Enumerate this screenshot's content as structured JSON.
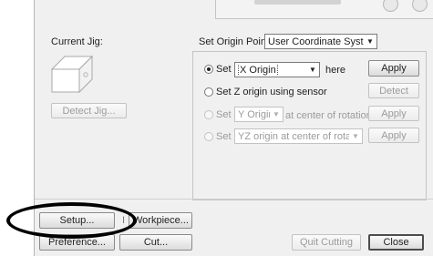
{
  "left": {
    "current_jig_label": "Current Jig:",
    "detect_jig_button": "Detect Jig..."
  },
  "origin": {
    "set_origin_point_label": "Set Origin Point",
    "coordinate_system": "User Coordinate System",
    "rows": [
      {
        "set_label": "Set",
        "select_value": "X Origin",
        "suffix": "here",
        "button": "Apply"
      },
      {
        "label": "Set Z origin using sensor",
        "button": "Detect"
      },
      {
        "set_label": "Set",
        "select_value": "Y Origin",
        "suffix": "at center of rotation",
        "button": "Apply"
      },
      {
        "set_label": "Set",
        "select_value": "YZ origin at center of rotation",
        "button": "Apply"
      }
    ]
  },
  "bottom": {
    "setup_button": "Setup...",
    "workpiece_button": "Workpiece...",
    "workpiece_prefix": "I",
    "preference_button": "Preference...",
    "cut_button": "Cut...",
    "quit_cutting_button": "Quit Cutting",
    "close_button": "Close"
  }
}
